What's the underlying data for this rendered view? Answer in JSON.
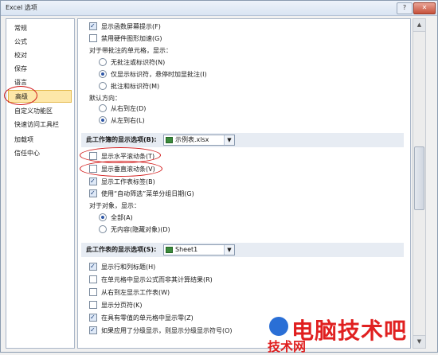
{
  "window": {
    "title": "Excel 选项"
  },
  "sidebar": {
    "items": [
      {
        "label": "常规"
      },
      {
        "label": "公式"
      },
      {
        "label": "校对"
      },
      {
        "label": "保存"
      },
      {
        "label": "语言"
      },
      {
        "label": "高级",
        "selected": true
      },
      {
        "label": "自定义功能区"
      },
      {
        "label": "快速访问工具栏"
      },
      {
        "label": "加载项"
      },
      {
        "label": "信任中心"
      }
    ]
  },
  "content": {
    "top_checkboxes": [
      {
        "label": "显示函数屏幕提示(F)",
        "checked": true
      },
      {
        "label": "禁用硬件图形加速(G)",
        "checked": false
      }
    ],
    "comments_group": {
      "label": "对于带批注的单元格，显示：",
      "options": [
        {
          "label": "无批注或标识符(N)",
          "checked": false
        },
        {
          "label": "仅显示标识符，悬停时加显批注(I)",
          "checked": true
        },
        {
          "label": "批注和标识符(M)",
          "checked": false
        }
      ]
    },
    "direction_group": {
      "label": "默认方向：",
      "options": [
        {
          "label": "从右到左(D)",
          "checked": false
        },
        {
          "label": "从左到右(L)",
          "checked": true
        }
      ]
    },
    "workbook_section": {
      "title": "此工作簿的显示选项(B):",
      "dropdown_value": "示例表.xlsx",
      "checkboxes": [
        {
          "label": "显示水平滚动条(T)",
          "checked": false
        },
        {
          "label": "显示垂直滚动条(V)",
          "checked": false
        },
        {
          "label": "显示工作表标签(B)",
          "checked": true
        },
        {
          "label": "使用“自动筛选”菜单分组日期(G)",
          "checked": true
        }
      ],
      "objects_label": "对于对象，显示：",
      "objects_options": [
        {
          "label": "全部(A)",
          "checked": true
        },
        {
          "label": "无内容(隐藏对象)(D)",
          "checked": false
        }
      ]
    },
    "worksheet_section": {
      "title": "此工作表的显示选项(S):",
      "dropdown_value": "Sheet1",
      "checkboxes": [
        {
          "label": "显示行和列标题(H)",
          "checked": true
        },
        {
          "label": "在单元格中显示公式而非其计算结果(R)",
          "checked": false
        },
        {
          "label": "从右到左显示工作表(W)",
          "checked": false
        },
        {
          "label": "显示分页符(K)",
          "checked": false
        },
        {
          "label": "在具有零值的单元格中显示零(Z)",
          "checked": true
        },
        {
          "label": "如果应用了分级显示，则显示分级显示符号(O)",
          "checked": true
        }
      ]
    }
  },
  "watermark": {
    "text": "电脑技术吧",
    "sub": "技术网"
  },
  "colors": {
    "selected_bg": "#fde7a9",
    "annotation_red": "#d11a1a",
    "section_header_bg": "#e7ecf3"
  }
}
